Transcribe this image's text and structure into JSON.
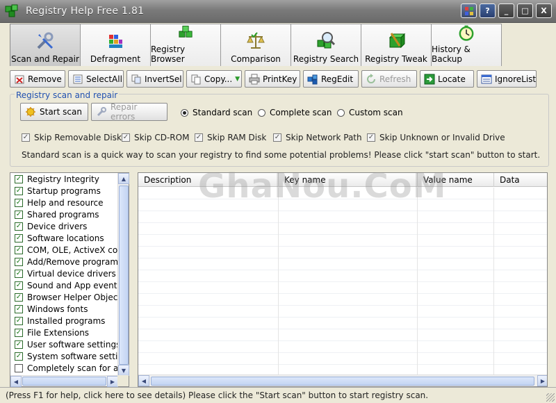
{
  "window": {
    "title": "Registry Help Free 1.81",
    "buttons": {
      "minimize": "_",
      "maximize": "□",
      "close": "X",
      "help": "?"
    }
  },
  "tabs": [
    {
      "label": "Scan and Repair",
      "icon": "wrench-screwdriver-icon",
      "active": true
    },
    {
      "label": "Defragment",
      "icon": "defragment-icon",
      "active": false
    },
    {
      "label": "Registry Browser",
      "icon": "green-cubes-icon",
      "active": false
    },
    {
      "label": "Comparison",
      "icon": "balance-scale-icon",
      "active": false
    },
    {
      "label": "Registry Search",
      "icon": "magnifier-cubes-icon",
      "active": false
    },
    {
      "label": "Registry Tweak",
      "icon": "tweak-cube-icon",
      "active": false
    },
    {
      "label": "History & Backup",
      "icon": "clock-icon",
      "active": false
    }
  ],
  "toolbar": {
    "remove": "Remove",
    "select_all": "SelectAll",
    "invert_sel": "InvertSel",
    "copy": "Copy...",
    "print_key": "PrintKey",
    "regedit": "RegEdit",
    "refresh": "Refresh",
    "locate": "Locate",
    "ignore_list": "IgnoreList"
  },
  "scan_group": {
    "title": "Registry scan and repair",
    "start_scan": "Start scan",
    "repair_errors": "Repair errors",
    "scan_modes": [
      {
        "label": "Standard scan",
        "selected": true
      },
      {
        "label": "Complete scan",
        "selected": false
      },
      {
        "label": "Custom scan",
        "selected": false
      }
    ],
    "skip_options": [
      {
        "label": "Skip Removable Disk",
        "checked": true
      },
      {
        "label": "Skip CD-ROM",
        "checked": true
      },
      {
        "label": "Skip RAM Disk",
        "checked": true
      },
      {
        "label": "Skip Network Path",
        "checked": true
      },
      {
        "label": "Skip Unknown or Invalid Drive",
        "checked": true
      }
    ],
    "description": "Standard scan is a quick way to scan your registry to find some potential problems! Please click \"start scan\" button to start."
  },
  "categories": [
    {
      "label": "Registry Integrity",
      "checked": true
    },
    {
      "label": "Startup programs",
      "checked": true
    },
    {
      "label": "Help and resource",
      "checked": true
    },
    {
      "label": "Shared programs",
      "checked": true
    },
    {
      "label": "Device drivers",
      "checked": true
    },
    {
      "label": "Software locations",
      "checked": true
    },
    {
      "label": "COM, OLE, ActiveX con",
      "checked": true
    },
    {
      "label": "Add/Remove programs",
      "checked": true
    },
    {
      "label": "Virtual device drivers",
      "checked": true
    },
    {
      "label": "Sound and App events",
      "checked": true
    },
    {
      "label": "Browser Helper Objects",
      "checked": true
    },
    {
      "label": "Windows fonts",
      "checked": true
    },
    {
      "label": "Installed programs",
      "checked": true
    },
    {
      "label": "File Extensions",
      "checked": true
    },
    {
      "label": "User software settings",
      "checked": true
    },
    {
      "label": "System software settin",
      "checked": true
    },
    {
      "label": "Completely scan for all r",
      "checked": false
    }
  ],
  "results_table": {
    "columns": [
      "Description",
      "Key name",
      "Value name",
      "Data"
    ]
  },
  "watermark": "GhaNou.CoM",
  "status": "(Press F1 for help, click here to see details) Please click the \"Start scan\" button to start registry scan."
}
